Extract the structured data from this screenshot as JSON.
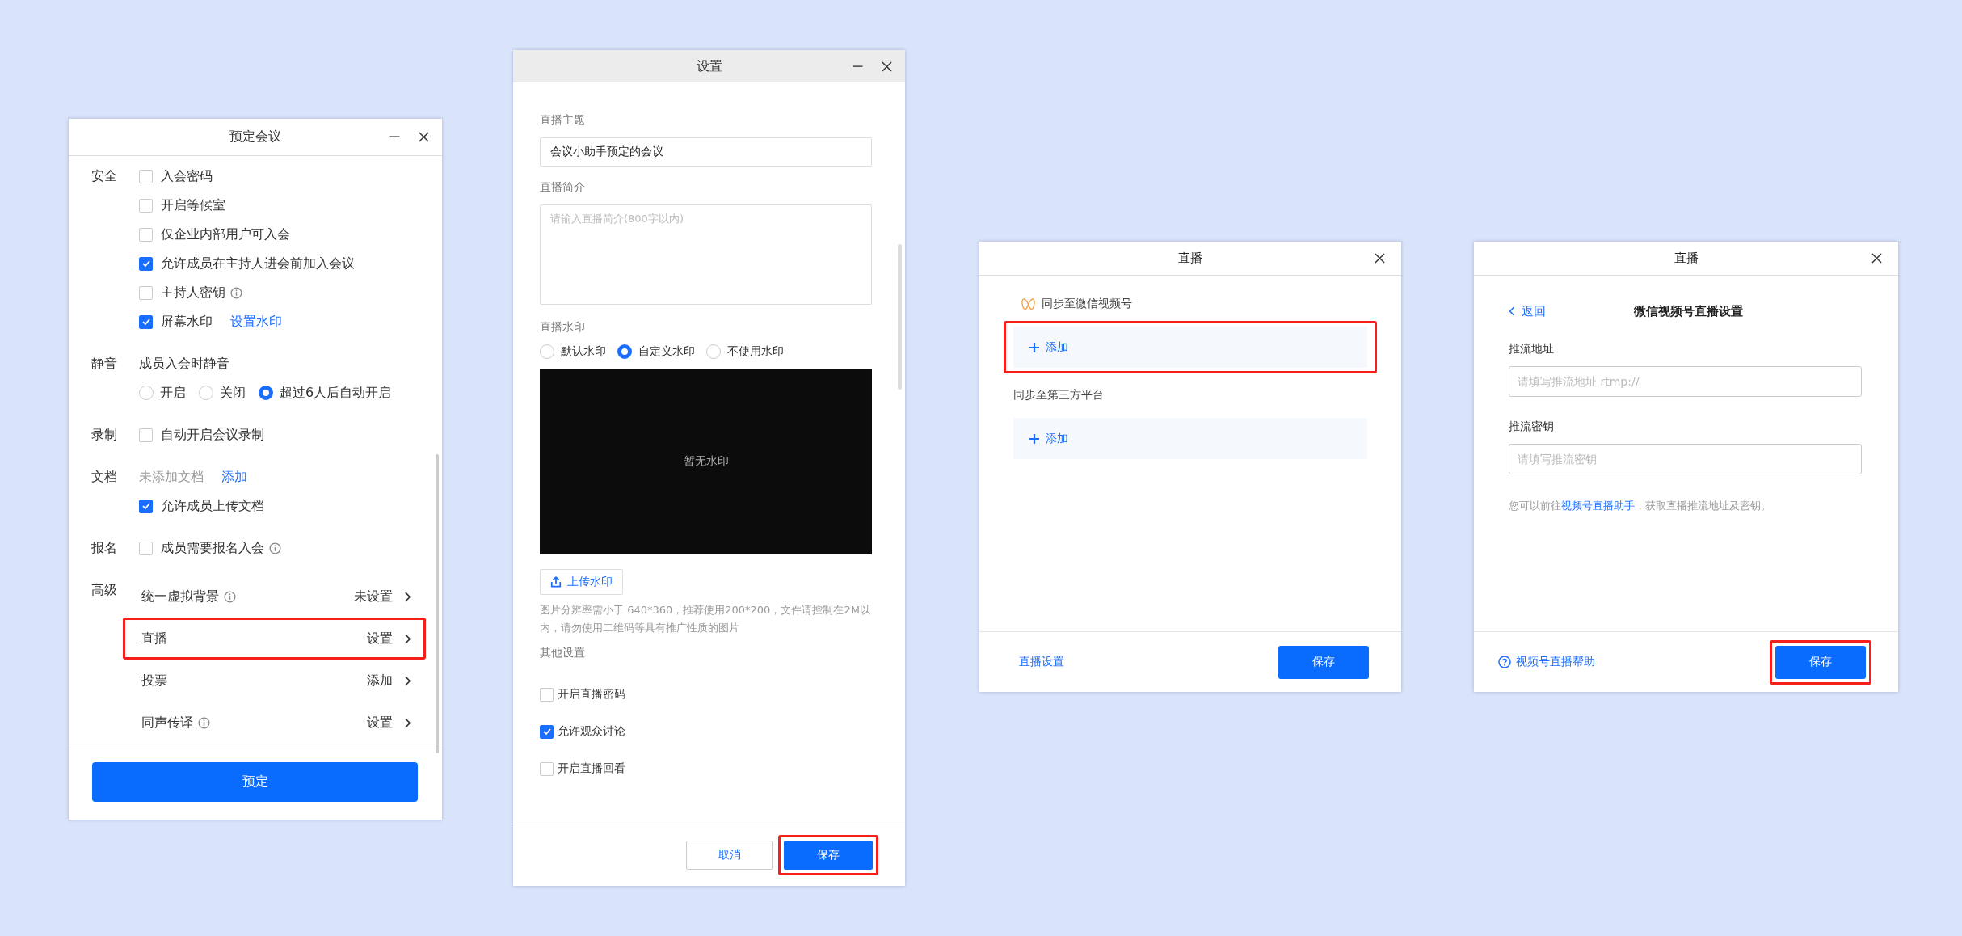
{
  "booking_window": {
    "title": "预定会议",
    "sections": [
      {
        "label": "安全",
        "items": [
          {
            "kind": "checkbox",
            "label": "入会密码",
            "checked": false
          },
          {
            "kind": "checkbox",
            "label": "开启等候室",
            "checked": false
          },
          {
            "kind": "checkbox",
            "label": "仅企业内部用户可入会",
            "checked": false
          },
          {
            "kind": "checkbox",
            "label": "允许成员在主持人进会前加入会议",
            "checked": true
          },
          {
            "kind": "checkbox",
            "label": "主持人密钥",
            "checked": false,
            "info": true
          },
          {
            "kind": "checkbox",
            "label": "屏幕水印",
            "checked": true,
            "link": "设置水印"
          }
        ]
      },
      {
        "label": "静音",
        "items": [
          {
            "kind": "text",
            "label": "成员入会时静音"
          },
          {
            "kind": "radios",
            "options": [
              {
                "label": "开启",
                "selected": false
              },
              {
                "label": "关闭",
                "selected": false
              },
              {
                "label": "超过6人后自动开启",
                "selected": true
              }
            ]
          }
        ]
      },
      {
        "label": "录制",
        "items": [
          {
            "kind": "checkbox",
            "label": "自动开启会议录制",
            "checked": false
          }
        ]
      },
      {
        "label": "文档",
        "items": [
          {
            "kind": "status",
            "label": "未添加文档",
            "link": "添加"
          },
          {
            "kind": "checkbox",
            "label": "允许成员上传文档",
            "checked": true
          }
        ]
      },
      {
        "label": "报名",
        "items": [
          {
            "kind": "checkbox",
            "label": "成员需要报名入会",
            "checked": false,
            "info": true
          }
        ]
      },
      {
        "label": "高级",
        "items": [
          {
            "kind": "nav",
            "label": "统一虚拟背景",
            "info": true,
            "value": "未设置",
            "highlighted": false
          },
          {
            "kind": "nav",
            "label": "直播",
            "value": "设置",
            "highlighted": true
          },
          {
            "kind": "nav",
            "label": "投票",
            "value": "添加",
            "highlighted": false
          },
          {
            "kind": "nav",
            "label": "同声传译",
            "info": true,
            "value": "设置",
            "highlighted": false
          }
        ]
      }
    ],
    "primary_button": "预定"
  },
  "settings_window": {
    "title": "设置",
    "topic": {
      "label": "直播主题",
      "value": "会议小助手预定的会议"
    },
    "intro": {
      "label": "直播简介",
      "placeholder": "请输入直播简介(800字以内)"
    },
    "watermark": {
      "label": "直播水印",
      "options": [
        {
          "label": "默认水印",
          "selected": false
        },
        {
          "label": "自定义水印",
          "selected": true
        },
        {
          "label": "不使用水印",
          "selected": false
        }
      ],
      "preview_text": "暂无水印",
      "upload_button": "上传水印",
      "hint": "图片分辨率需小于 640*360，推荐使用200*200，文件请控制在2M以内，请勿使用二维码等具有推广性质的图片"
    },
    "other": {
      "label": "其他设置",
      "options": [
        {
          "label": "开启直播密码",
          "checked": false
        },
        {
          "label": "允许观众讨论",
          "checked": true
        },
        {
          "label": "开启直播回看",
          "checked": false
        }
      ]
    },
    "buttons": [
      {
        "kind": "secondary",
        "label": "取消",
        "highlighted": false
      },
      {
        "kind": "primary",
        "label": "保存",
        "highlighted": true
      }
    ]
  },
  "live_window": {
    "title": "直播",
    "targets": [
      {
        "label": "同步至微信视频号",
        "icon": true,
        "add_label": "添加",
        "highlighted": true
      },
      {
        "label": "同步至第三方平台",
        "icon": false,
        "add_label": "添加",
        "highlighted": false
      }
    ],
    "settings_link": "直播设置",
    "save_button": {
      "label": "保存",
      "highlighted": false
    }
  },
  "wechat_window": {
    "title": "直播",
    "back_link": "返回",
    "heading": "微信视频号直播设置",
    "fields": [
      {
        "label": "推流地址",
        "placeholder": "请填写推流地址 rtmp://"
      },
      {
        "label": "推流密钥",
        "placeholder": "请填写推流密钥"
      }
    ],
    "note_before": "您可以前往",
    "note_link": "视频号直播助手",
    "note_after": "，获取直播推流地址及密钥。",
    "help_link": "视频号直播帮助",
    "save_button": {
      "label": "保存",
      "highlighted": true
    }
  }
}
